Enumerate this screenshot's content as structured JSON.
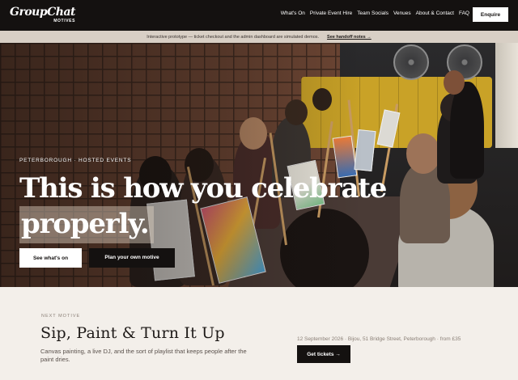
{
  "header": {
    "logo": "GroupChat",
    "logo_sub": "MOTIVES",
    "nav": [
      "What's On",
      "Private Event Hire",
      "Team Socials",
      "Venues",
      "About & Contact",
      "FAQ"
    ],
    "cta": "Enquire"
  },
  "banner": {
    "text": "Interactive prototype — ticket checkout and the admin dashboard are simulated demos.",
    "link": "See handoff notes →"
  },
  "hero": {
    "eyebrow": "PETERBOROUGH · HOSTED EVENTS",
    "headline_line1": "This is how you celebrate",
    "headline_line2": "properly.",
    "primary_button": "See what's on",
    "secondary_button": "Plan your own motive"
  },
  "next": {
    "label": "NEXT MOTIVE",
    "title": "Sip, Paint & Turn It Up",
    "description": "Canvas painting, a live DJ, and the sort of playlist that keeps people after the paint dries.",
    "meta": "12 September 2026 · Bijou, 51 Bridge Street, Peterborough · from £35",
    "button": "Get tickets →"
  },
  "colors": {
    "nav_bg": "#141110",
    "page_bg": "#f3efea",
    "banner_bg": "#d8cfc5",
    "bench_yellow": "#c9a227"
  }
}
